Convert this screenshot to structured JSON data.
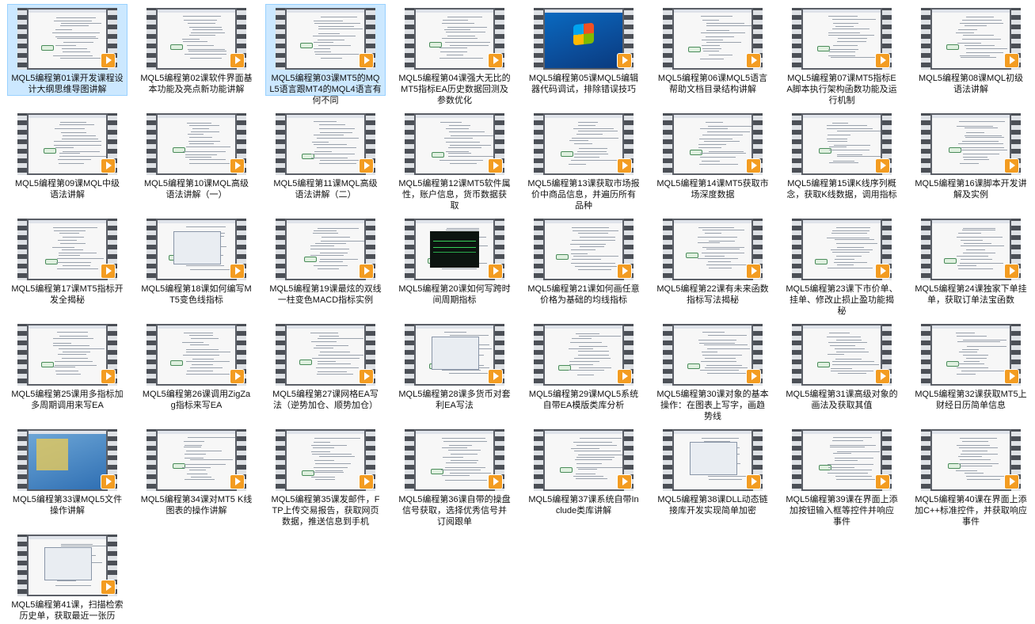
{
  "files": [
    {
      "name": "MQL5编程第01课开发课程设计大纲思维导图讲解",
      "thumb": "mindmap",
      "selected": true
    },
    {
      "name": "MQL5编程第02课软件界面基本功能及亮点新功能讲解",
      "thumb": "mindmap"
    },
    {
      "name": "MQL5编程第03课MT5的MQL5语言跟MT4的MQL4语言有何不同",
      "thumb": "mindmap",
      "selected": true
    },
    {
      "name": "MQL5编程第04课强大无比的MT5指标EA历史数据回测及参数优化",
      "thumb": "mindmap"
    },
    {
      "name": "MQL5编程第05课MQL5编辑器代码调试，排除错误技巧",
      "thumb": "windows"
    },
    {
      "name": "MQL5编程第06课MQL5语言帮助文档目录结构讲解",
      "thumb": "mindmap"
    },
    {
      "name": "MQL5编程第07课MT5指标EA脚本执行架构函数功能及运行机制",
      "thumb": "mindmap"
    },
    {
      "name": "MQL5编程第08课MQL初级语法讲解",
      "thumb": "mindmap"
    },
    {
      "name": "MQL5编程第09课MQL中级语法讲解",
      "thumb": "mindmap"
    },
    {
      "name": "MQL5编程第10课MQL高级语法讲解（一）",
      "thumb": "mindmap"
    },
    {
      "name": "MQL5编程第11课MQL高级语法讲解（二）",
      "thumb": "mindmap"
    },
    {
      "name": "MQL5编程第12课MT5软件属性，账户信息，货币数据获取",
      "thumb": "mindmap"
    },
    {
      "name": "MQL5编程第13课获取市场报价中商品信息，并遍历所有品种",
      "thumb": "mindmap"
    },
    {
      "name": "MQL5编程第14课MT5获取市场深度数据",
      "thumb": "mindmap"
    },
    {
      "name": "MQL5编程第15课K线序列概念，获取K线数据，调用指标",
      "thumb": "mindmap"
    },
    {
      "name": "MQL5编程第16课脚本开发讲解及实例",
      "thumb": "mindmap"
    },
    {
      "name": "MQL5编程第17课MT5指标开发全揭秘",
      "thumb": "mindmap"
    },
    {
      "name": "MQL5编程第18课如何编写MT5变色线指标",
      "thumb": "dialog"
    },
    {
      "name": "MQL5编程第19课最炫的双线一柱变色MACD指标实例",
      "thumb": "mindmap"
    },
    {
      "name": "MQL5编程第20课如何写跨时间周期指标",
      "thumb": "chart"
    },
    {
      "name": "MQL5编程第21课如何画任意价格为基础的均线指标",
      "thumb": "mindmap"
    },
    {
      "name": "MQL5编程第22课有未来函数指标写法揭秘",
      "thumb": "mindmap"
    },
    {
      "name": "MQL5编程第23课下市价单、挂单、修改止损止盈功能揭秘",
      "thumb": "mindmap"
    },
    {
      "name": "MQL5编程第24课独家下单挂单，获取订单法宝函数",
      "thumb": "mindmap"
    },
    {
      "name": "MQL5编程第25课用多指标加多周期调用来写EA",
      "thumb": "mindmap"
    },
    {
      "name": "MQL5编程第26课调用ZigZag指标来写EA",
      "thumb": "mindmap"
    },
    {
      "name": "MQL5编程第27课网格EA写法（逆势加仓、顺势加仓）",
      "thumb": "mindmap"
    },
    {
      "name": "MQL5编程第28课多货币对套利EA写法",
      "thumb": "dialog"
    },
    {
      "name": "MQL5编程第29课MQL5系统自带EA模版类库分析",
      "thumb": "mindmap"
    },
    {
      "name": "MQL5编程第30课对象的基本操作：在图表上写字，画趋势线",
      "thumb": "mindmap"
    },
    {
      "name": "MQL5编程第31课高级对象的画法及获取其值",
      "thumb": "mindmap"
    },
    {
      "name": "MQL5编程第32课获取MT5上财经日历简单信息",
      "thumb": "mindmap"
    },
    {
      "name": "MQL5编程第33课MQL5文件操作讲解",
      "thumb": "desktop"
    },
    {
      "name": "MQL5编程第34课对MT5 K线图表的操作讲解",
      "thumb": "mindmap"
    },
    {
      "name": "MQL5编程第35课发邮件，FTP上传交易报告，获取网页数据，推送信息到手机",
      "thumb": "mindmap"
    },
    {
      "name": "MQL5编程第36课自带的操盘信号获取，选择优秀信号并订阅跟单",
      "thumb": "mindmap"
    },
    {
      "name": "MQL5编程第37课系统自带Include类库讲解",
      "thumb": "mindmap"
    },
    {
      "name": "MQL5编程第38课DLL动态链接库开发实现简单加密",
      "thumb": "dialog"
    },
    {
      "name": "MQL5编程第39课在界面上添加按钮输入框等控件并响应事件",
      "thumb": "mindmap"
    },
    {
      "name": "MQL5编程第40课在界面上添加C++标准控件，并获取响应事件",
      "thumb": "mindmap"
    },
    {
      "name": "MQL5编程第41课，扫描检索历史单，获取最近一张历",
      "thumb": "dialog"
    }
  ]
}
